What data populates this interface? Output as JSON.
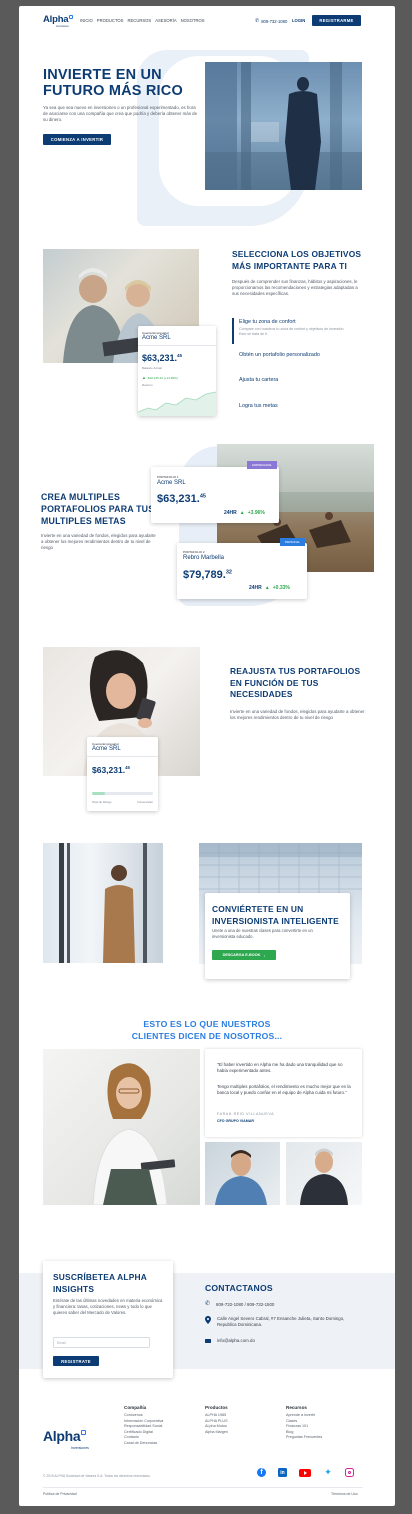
{
  "header": {
    "logo": "Alpha",
    "logo_sub": "Inversiones",
    "nav": [
      "INICIO",
      "PRODUCTOS",
      "RECURSOS",
      "ASESORÍA",
      "NOSOTROS"
    ],
    "phone": "809-732-1080",
    "login": "LOGIN",
    "register": "REGISTRARME"
  },
  "hero": {
    "title_line1": "INVIERTE EN UN",
    "title_line2": "FUTURO MÁS RICO",
    "text": "Ya sea que sea nuevo en inversiones o un profesional experimentado, es hora de asociarse con una compañía que crea que podría y debería obtener más de su dinero.",
    "cta": "COMIENZA A INVERTIR"
  },
  "objectives": {
    "title": "SELECCIONA LOS OBJETIVOS MÁS IMPORTANTE PARA TI",
    "text": "Después de comprender sus finanzas, hábitos y aspiraciones, le proporcionamos las recomendaciones y estrategias adaptadas a sus necesidades específicas.",
    "items": [
      {
        "label": "Elige tu zona de confort",
        "desc": "Compare con nosotros tu zona de confort y objetivos de inversión. Esto se trata de ti."
      },
      {
        "label": "Obtén un portafolio personalizado"
      },
      {
        "label": "Ajusta tu cartera"
      },
      {
        "label": "Logra tus metas"
      }
    ],
    "card": {
      "label": "Cuenta Empresarial",
      "name": "Acme SRL",
      "amount": "$63,231.",
      "cents": "45",
      "balance": "Balance Actual",
      "change": "$10,425.22 (+14.99%)",
      "returns": "Retorno"
    }
  },
  "portfolios": {
    "title": "CREA MULTIPLES PORTAFOLIOS PARA TUS MULTIPLES METAS",
    "text": "Invierte en una variedad de fondos, elegidos para ayudarte a obtener los mejores rendimientos dentro de tu nivel de riesgo",
    "card1": {
      "label": "PORTAFOLIO 1",
      "name": "Acme SRL",
      "amount": "$63,231.",
      "cents": "45",
      "period": "24HR",
      "change": "+3.96%",
      "tag": "EMPRESARIAL"
    },
    "card2": {
      "label": "PORTAFOLIO 2",
      "name": "Rebro Marbella",
      "amount": "$79,789.",
      "cents": "32",
      "period": "24HR",
      "change": "+0.33%",
      "tag": "PERSONAL"
    }
  },
  "adjust": {
    "title": "REAJUSTA TUS PORTAFOLIOS EN FUNCIÓN DE TUS NECESIDADES",
    "text": "Invierte en una variedad de fondos, elegidos para ayudarte a obtener los mejores rendimientos dentro de tu nivel de riesgo",
    "card": {
      "label": "Cuenta Empresarial",
      "name": "Acme SRL",
      "amount": "$63,231.",
      "cents": "45",
      "risk_low": "Nivel de Riesgo",
      "risk_high": "Conservador",
      "risk_level": 0.22
    }
  },
  "investor": {
    "title": "CONVIÉRTETE EN UN INVERSIONISTA INTELIGENTE",
    "text": "Unete a una de nuestras clases para convertirte en un inversionista educado.",
    "cta": "DESCARGA E-BOOK"
  },
  "testimonials": {
    "title_line1": "ESTO ES LO QUE NUESTROS",
    "title_line2": "CLIENTES DICEN DE NOSOTROS...",
    "quote1": "\"El haber invertido en Alpha me ha dado una tranquilidad que no había experimentado antes.",
    "quote2": "Tengo multiples portafolios, el rendimiento es mucho mejor que en la banca local y puedo confiar en el equipo de Alpha cuida mi futuro.\"",
    "author": "FARAH REID VILLANUEVA",
    "role": "CFO GRUPO VIAMAR"
  },
  "subscribe": {
    "title": "SUSCRÍBETEA ALPHA INSIGHTS",
    "text": "Entérate de las últimas novedades en materia económica y financiera: tasas, cotizaciones, news y todo lo que quieres saber del Mercado de Valores.",
    "placeholder": "Email",
    "button": "REGISTRATE"
  },
  "contact": {
    "title": "CONTACTANOS",
    "phone": "809-732-1080  /  809-732-1500",
    "address": "Calle Angel Severo Cabral, #7 Ensanche Julieta, Santo Domingo, Republica Dominicana.",
    "email": "info@alpha.com.do"
  },
  "footer": {
    "logo": "Alpha",
    "logo_sub": "Inversiones",
    "col1": {
      "title": "Compañía",
      "links": [
        "Conócenos",
        "Información Corporativa",
        "Responsabilidad Social",
        "Certificado Digital",
        "Contacto",
        "Canal de Denuncias"
      ]
    },
    "col2": {
      "title": "Productos",
      "links": [
        "ALPHA 1985",
        "ALPHA PLUS",
        "ALpha Mutuo",
        "Alpha Margen"
      ]
    },
    "col3": {
      "title": "Recursos",
      "links": [
        "Aprende a invertir",
        "Clases",
        "Finanzas 101",
        "Blog",
        "Preguntas Frecuentes"
      ]
    },
    "copyright": "© 2019 ALPHA Sociedad de Valores S.A. Todos los derechos reservados.",
    "privacy": "Política de Privacidad",
    "terms": "Términos de Uso"
  },
  "colors": {
    "navy": "#0d3c74",
    "green": "#2ea84e",
    "accent_light": "#e8eef7"
  }
}
